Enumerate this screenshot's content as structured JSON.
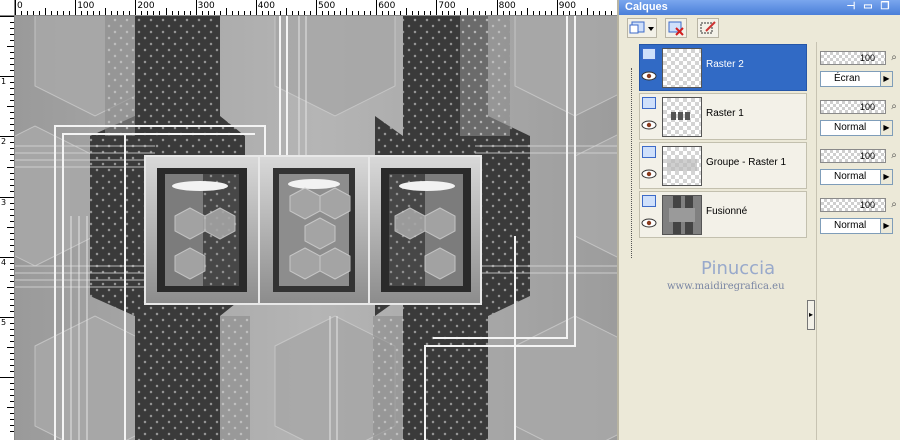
{
  "ruler": {
    "top_labels": [
      "0",
      "100",
      "200",
      "300",
      "400",
      "500",
      "600",
      "700",
      "800",
      "900"
    ],
    "left_labels": [
      "1",
      "2",
      "3",
      "4",
      "5"
    ]
  },
  "palette": {
    "title": "Calques",
    "title_buttons": [
      "⊣",
      "✕",
      "❐",
      "✕"
    ],
    "layers": [
      {
        "name": "Raster 2",
        "selected": true,
        "opacity": "100",
        "blend": "Écran"
      },
      {
        "name": "Raster 1",
        "selected": false,
        "opacity": "100",
        "blend": "Normal"
      },
      {
        "name": "Groupe - Raster 1",
        "selected": false,
        "opacity": "100",
        "blend": "Normal"
      },
      {
        "name": "Fusionné",
        "selected": false,
        "opacity": "100",
        "blend": "Normal"
      }
    ],
    "toolbar_icons": [
      "new-layer-icon",
      "delete-layer-icon",
      "edit-selection-icon"
    ]
  },
  "watermark": {
    "name": "Pinuccia",
    "url": "www.maidiregrafica.eu"
  },
  "colors": {
    "selected": "#316ac5",
    "title_bar": "#4a7fd9"
  }
}
